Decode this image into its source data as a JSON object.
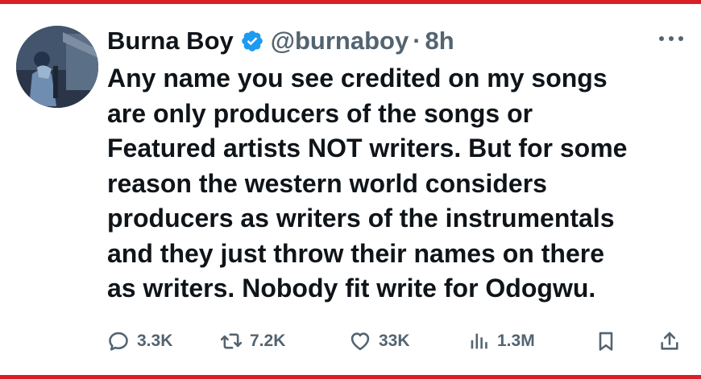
{
  "tweet": {
    "display_name": "Burna Boy",
    "handle": "@burnaboy",
    "separator": "·",
    "time": "8h",
    "text": "Any name you see credited on my songs\nare only producers of the songs or\nFeatured artists NOT writers. But for some\nreason the western world considers\nproducers as writers of the instrumentals\nand they just throw their names on there\nas writers. Nobody fit write for Odogwu."
  },
  "actions": {
    "replies": "3.3K",
    "retweets": "7.2K",
    "likes": "33K",
    "views": "1.3M"
  },
  "icons": {
    "verified": "verified-badge-icon",
    "more": "more-options-icon",
    "reply": "reply-icon",
    "retweet": "retweet-icon",
    "like": "heart-icon",
    "views": "views-icon",
    "bookmark": "bookmark-icon",
    "share": "share-icon"
  },
  "colors": {
    "border_bar": "#d91f26",
    "verified": "#1d9bf0",
    "secondary_text": "#536471",
    "primary_text": "#0f1419"
  }
}
